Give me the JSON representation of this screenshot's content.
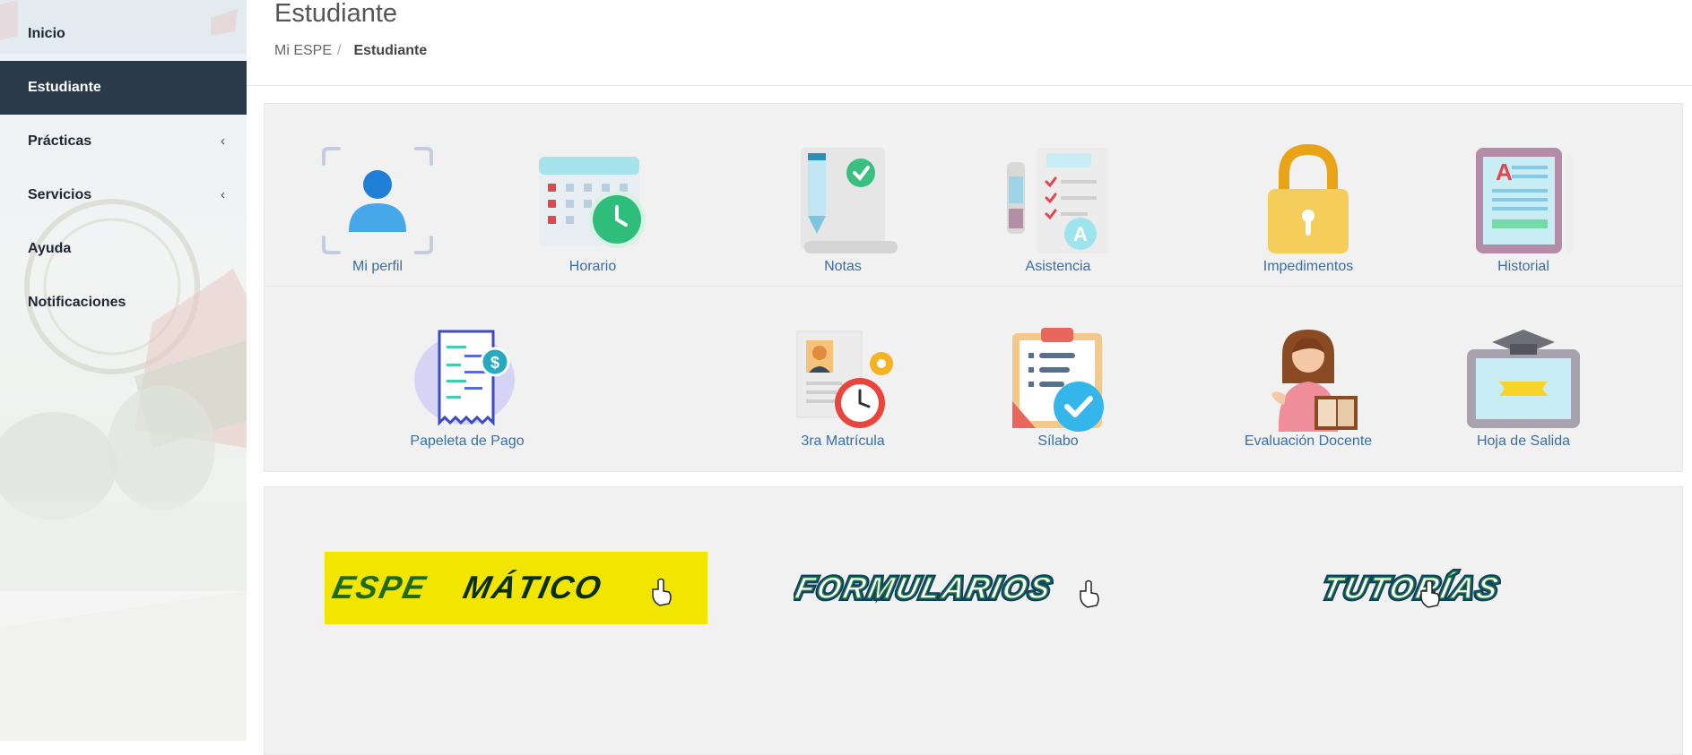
{
  "sidebar": {
    "items": [
      {
        "label": "Inicio"
      },
      {
        "label": "Estudiante"
      },
      {
        "label": "Prácticas",
        "chevron": "‹"
      },
      {
        "label": "Servicios",
        "chevron": "‹"
      },
      {
        "label": "Ayuda"
      },
      {
        "label": "Notificaciones"
      }
    ]
  },
  "header": {
    "title": "Estudiante",
    "breadcrumb": {
      "root": "Mi ESPE",
      "separator": "/",
      "current": "Estudiante"
    }
  },
  "row1": [
    {
      "label": "Mi perfil",
      "icon": "user-profile-icon"
    },
    {
      "label": "Horario",
      "icon": "calendar-clock-icon"
    },
    {
      "label": "Notas",
      "icon": "grades-scroll-icon"
    },
    {
      "label": "Asistencia",
      "icon": "attendance-checklist-icon"
    },
    {
      "label": "Impedimentos",
      "icon": "padlock-icon"
    },
    {
      "label": "Historial",
      "icon": "tablet-history-icon"
    }
  ],
  "row2": [
    {
      "label": "Papeleta de Pago",
      "icon": "payment-receipt-icon"
    },
    {
      "label": "3ra Matrícula",
      "icon": "third-enrollment-icon"
    },
    {
      "label": "Sílabo",
      "icon": "syllabus-clipboard-icon"
    },
    {
      "label": "Evaluación Docente",
      "icon": "teacher-evaluation-icon"
    },
    {
      "label": "Hoja de Salida",
      "icon": "graduation-tablet-icon"
    }
  ],
  "banners": {
    "espematico": {
      "part1": "ESPE",
      "part2": "MÁTICO"
    },
    "formularios": {
      "text": "FORMULARIOS"
    },
    "tutorias": {
      "text": "TUTORÍAS"
    }
  },
  "colors": {
    "sidebar_active": "#2b3a48",
    "link": "#3a6ea5",
    "panel": "#f1f1f1",
    "banner_yellow": "#f2e600",
    "banner_green": "#1e6b1e"
  }
}
